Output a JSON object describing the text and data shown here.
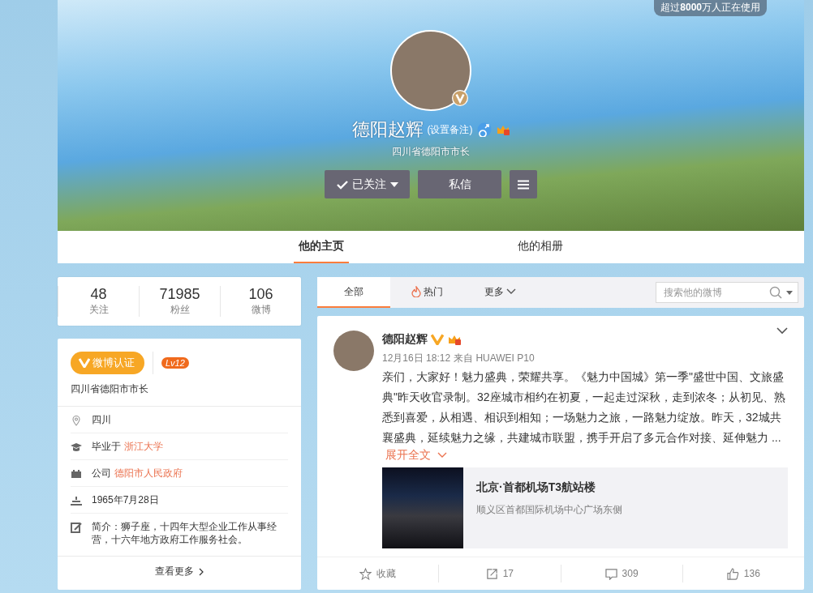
{
  "top_badge": {
    "text": "超过**8000**万人正在使用"
  },
  "profile": {
    "name": "德阳赵辉",
    "remark_link": "(设置备注)",
    "male": true,
    "verified": true,
    "title": "四川省德阳市市长",
    "buttons": [
      {
        "kind": "follow",
        "label": "已关注"
      },
      {
        "kind": "message",
        "label": "私信"
      },
      {
        "kind": "menu"
      }
    ]
  },
  "tabs": [
    {
      "label": "他的主页",
      "selected": true
    },
    {
      "label": "他的相册",
      "selected": false
    }
  ],
  "stats": [
    {
      "value": "48",
      "label": "关注"
    },
    {
      "value": "71985",
      "label": "粉丝"
    },
    {
      "value": "106",
      "label": "微博"
    }
  ],
  "info_card": {
    "verify_badge": "微博认证",
    "level_badge": "Lv12",
    "verify_title": "四川省德阳市市长",
    "items": [
      {
        "kind": "location",
        "text": "四川"
      },
      {
        "kind": "education",
        "text": "毕业于",
        "link": "浙江大学"
      },
      {
        "kind": "company",
        "text": "公司",
        "link": "德阳市人民政府"
      },
      {
        "kind": "birthday",
        "text": "1965年7月28日"
      },
      {
        "kind": "bio",
        "text": "简介：狮子座，十四年大型企业工作从事经营，十六年地方政府工作服务社会。"
      }
    ],
    "more": "查看更多"
  },
  "feed_tabs": [
    {
      "kind": "plain",
      "label": "全部",
      "selected": true
    },
    {
      "kind": "hot",
      "label": "热门",
      "selected": false
    },
    {
      "kind": "dropdown",
      "label": "更多",
      "selected": false
    }
  ],
  "search": {
    "placeholder": "搜索他的微博"
  },
  "post": {
    "author": "德阳赵辉",
    "verified": true,
    "time": "12月16日 18:12",
    "source": "来自 HUAWEI P10",
    "text": "亲们，大家好！魅力盛典，荣耀共享。《魅力中国城》第一季\"盛世中国、文旅盛典\"昨天收官录制。32座城市相约在初夏，一起走过深秋，走到浓冬；从初见、熟悉到喜爱，从相遇、相识到相知；一场魅力之旅，一路魅力绽放。昨天，32城共襄盛典，延续魅力之缘，共建城市联盟，携手开启了多元合作对接、延伸魅力 ...",
    "expand": "展开全文",
    "location_card": {
      "title": "北京·首都机场T3航站楼",
      "subtitle": "顺义区首都国际机场中心广场东侧"
    },
    "actions": [
      {
        "kind": "favorite",
        "label": "收藏"
      },
      {
        "kind": "repost",
        "label": "17"
      },
      {
        "kind": "comment",
        "label": "309"
      },
      {
        "kind": "like",
        "label": "136"
      }
    ]
  }
}
